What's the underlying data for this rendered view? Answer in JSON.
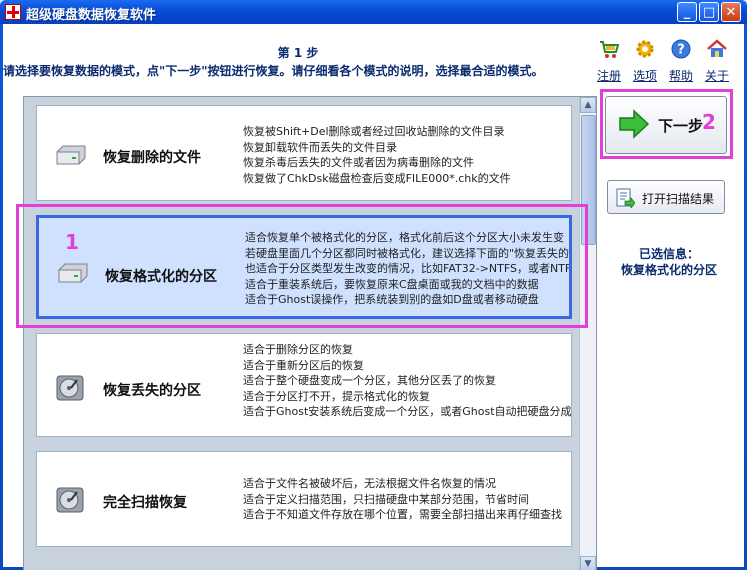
{
  "window": {
    "title": "超级硬盘数据恢复软件",
    "controls": {
      "minimize": "_",
      "maximize": "□",
      "close": "✕"
    }
  },
  "header": {
    "step": "第 1 步",
    "instruction": "请选择要恢复数据的模式，点\"下一步\"按钮进行恢复。请仔细看各个模式的说明，选择最合适的模式。"
  },
  "toolbar": [
    {
      "label": "注册",
      "icon": "cart-icon"
    },
    {
      "label": "选项",
      "icon": "gear-icon"
    },
    {
      "label": "帮助",
      "icon": "help-icon"
    },
    {
      "label": "关于",
      "icon": "home-icon"
    }
  ],
  "modes": [
    {
      "name": "恢复删除的文件",
      "selected": false,
      "lines": [
        "恢复被Shift+Del删除或者经过回收站删除的文件目录",
        "恢复卸载软件而丢失的文件目录",
        "恢复杀毒后丢失的文件或者因为病毒删除的文件",
        "恢复做了ChkDsk磁盘检查后变成FILE000*.chk的文件"
      ]
    },
    {
      "name": "恢复格式化的分区",
      "selected": true,
      "lines": [
        "适合恢复单个被格式化的分区，格式化前后这个分区大小未发生变",
        "若硬盘里面几个分区都同时被格式化，建议选择下面的\"恢复丢失的分",
        "也适合于分区类型发生改变的情况，比如FAT32->NTFS，或者NTFS",
        "适合于重装系统后，要恢复原来C盘桌面或我的文档中的数据",
        "适合于Ghost误操作，把系统装到别的盘如D盘或者移动硬盘"
      ]
    },
    {
      "name": "恢复丢失的分区",
      "selected": false,
      "lines": [
        "适合于删除分区的恢复",
        "适合于重新分区后的恢复",
        "适合于整个硬盘变成一个分区，其他分区丢了的恢复",
        "适合于分区打不开，提示格式化的恢复",
        "适合于Ghost安装系统后变成一个分区，或者Ghost自动把硬盘分成"
      ]
    },
    {
      "name": "完全扫描恢复",
      "selected": false,
      "lines": [
        "适合于文件名被破坏后，无法根据文件名恢复的情况",
        "适合于定义扫描范围，只扫描硬盘中某部分范围，节省时间",
        "适合于不知道文件存放在哪个位置，需要全部扫描出来再仔细查找"
      ]
    }
  ],
  "right_panel": {
    "next_label": "下一步",
    "open_scan_label": "打开扫描结果",
    "selected_info_title": "已选信息：",
    "selected_info_value": "恢复格式化的分区"
  },
  "annotations": {
    "marker_1": "1",
    "marker_2": "2"
  },
  "colors": {
    "highlight": "#e040d8",
    "selected_bg": "#cfe1ff",
    "selected_border": "#3a66e0",
    "heading": "#0a2b6e"
  }
}
